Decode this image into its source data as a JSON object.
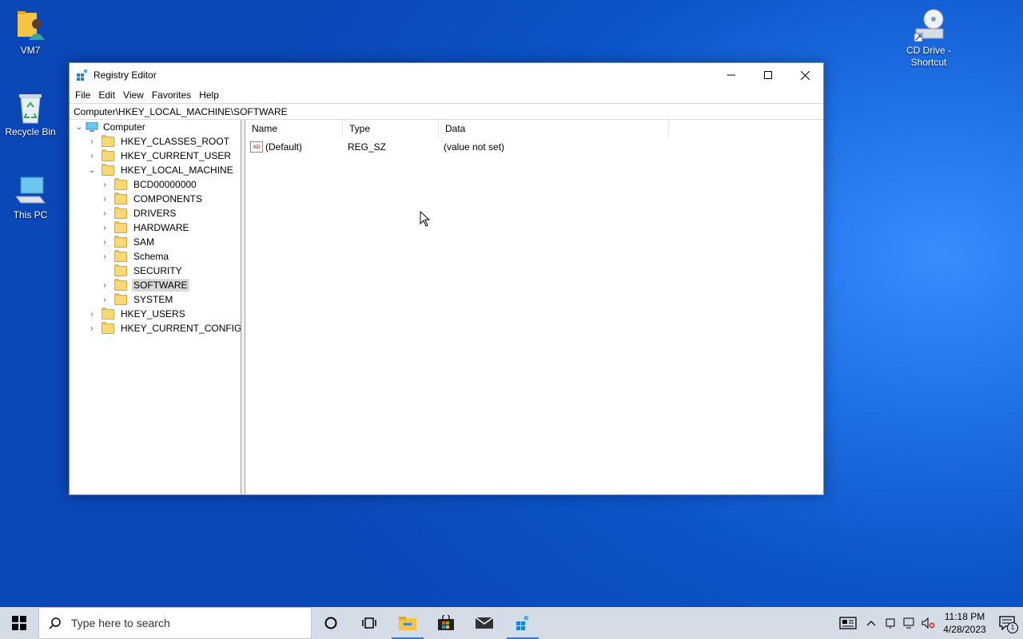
{
  "desktop": {
    "icons": [
      {
        "label": "VM7"
      },
      {
        "label": "Recycle Bin"
      },
      {
        "label": "This PC"
      },
      {
        "label": "CD Drive -\nShortcut"
      }
    ]
  },
  "window": {
    "title": "Registry Editor",
    "menu": [
      "File",
      "Edit",
      "View",
      "Favorites",
      "Help"
    ],
    "address": "Computer\\HKEY_LOCAL_MACHINE\\SOFTWARE",
    "tree": {
      "root": "Computer",
      "hives": [
        "HKEY_CLASSES_ROOT",
        "HKEY_CURRENT_USER",
        "HKEY_LOCAL_MACHINE",
        "HKEY_USERS",
        "HKEY_CURRENT_CONFIG"
      ],
      "hklm_children": [
        "BCD00000000",
        "COMPONENTS",
        "DRIVERS",
        "HARDWARE",
        "SAM",
        "Schema",
        "SECURITY",
        "SOFTWARE",
        "SYSTEM"
      ],
      "selected": "SOFTWARE"
    },
    "columns": [
      "Name",
      "Type",
      "Data"
    ],
    "values": [
      {
        "name": "(Default)",
        "type": "REG_SZ",
        "data": "(value not set)"
      }
    ]
  },
  "taskbar": {
    "search_placeholder": "Type here to search",
    "time": "11:18 PM",
    "date": "4/28/2023",
    "notification_count": "1"
  },
  "colors": {
    "accent": "#2c7be5",
    "selection": "#d9d9d9"
  }
}
